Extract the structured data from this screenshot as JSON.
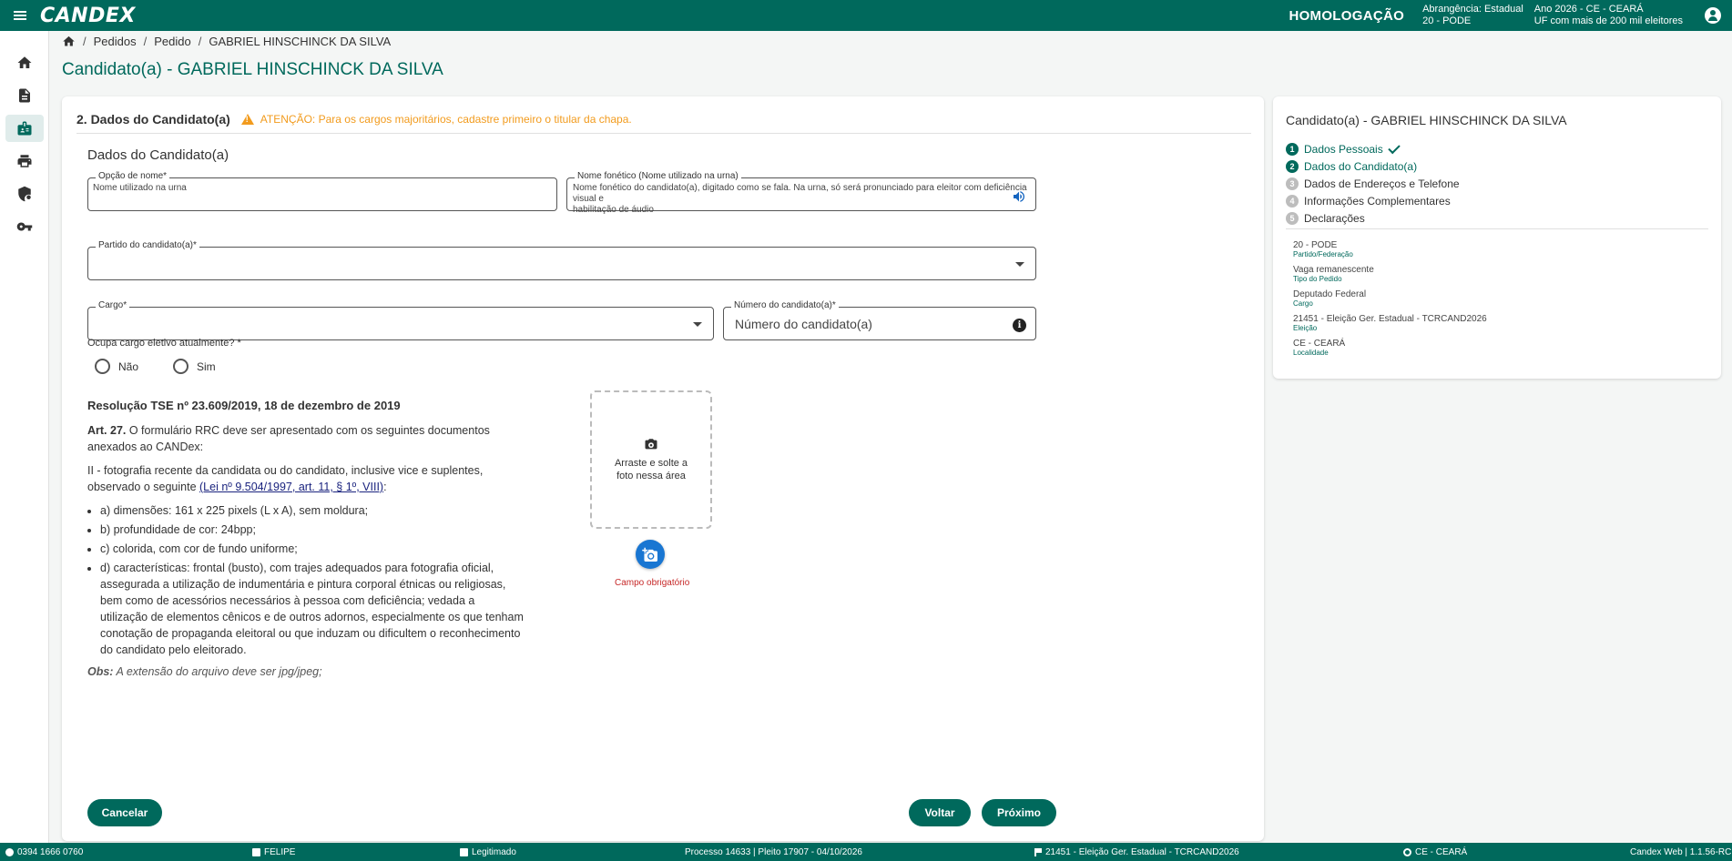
{
  "app": {
    "logo": "CANDEX"
  },
  "topbar": {
    "environment": "HOMOLOGAÇÃO",
    "scope_line1": "Abrangência: Estadual",
    "scope_line2": "20 - PODE",
    "year_line1": "Ano 2026 - CE - CEARÁ",
    "year_line2": "UF com mais de 200 mil eleitores"
  },
  "sidebar": {
    "items": [
      {
        "icon": "home-icon"
      },
      {
        "icon": "document-icon"
      },
      {
        "icon": "candidate-badge-icon",
        "active": true
      },
      {
        "icon": "print-icon"
      },
      {
        "icon": "shield-lock-icon"
      },
      {
        "icon": "key-icon"
      }
    ]
  },
  "breadcrumb": {
    "items": [
      "Pedidos",
      "Pedido",
      "GABRIEL HINSCHINCK DA SILVA"
    ]
  },
  "page_title": "Candidato(a) - GABRIEL HINSCHINCK DA SILVA",
  "section": {
    "title": "2. Dados do Candidato(a)",
    "warning": "ATENÇÃO: Para os cargos majoritários, cadastre primeiro o titular da chapa.",
    "subtitle": "Dados do Candidato(a)"
  },
  "form": {
    "opcao_nome": {
      "label": "Opção de nome*",
      "value": "",
      "hint": "Nome utilizado na urna"
    },
    "nome_fonetico": {
      "label": "Nome fonético (Nome utilizado na urna)",
      "value": "",
      "hint_line1": "Nome fonético do candidato(a), digitado como se fala. Na urna, só será pronunciado para eleitor com deficiência visual e",
      "hint_line2": "habilitação de áudio"
    },
    "partido": {
      "label": "Partido do candidato(a)*",
      "value": ""
    },
    "cargo": {
      "label": "Cargo*",
      "value": ""
    },
    "numero": {
      "label": "Número do candidato(a)*",
      "placeholder": "Número do candidato(a)"
    },
    "ocupa_cargo": {
      "question": "Ocupa cargo eletivo atualmente? *",
      "options": [
        "Não",
        "Sim"
      ]
    }
  },
  "resolution": {
    "title": "Resolução TSE nº 23.609/2019, 18 de dezembro de 2019",
    "art_label": "Art. 27.",
    "art_text": " O formulário RRC deve ser apresentado com os seguintes documentos anexados ao CANDex:",
    "item_intro": "II - fotografia recente da candidata ou do candidato, inclusive vice e suplentes, observado o seguinte ",
    "law_link": "(Lei nº 9.504/1997, art. 11, § 1º, VIII)",
    "law_link_suffix": ":",
    "items": [
      "a) dimensões: 161 x 225 pixels (L x A), sem moldura;",
      "b) profundidade de cor: 24bpp;",
      "c) colorida, com cor de fundo uniforme;",
      "d) características: frontal (busto), com trajes adequados para fotografia oficial, assegurada a utilização de indumentária e pintura corporal étnicas ou religiosas, bem como de acessórios necessários à pessoa com deficiência; vedada a utilização de elementos cênicos e de outros adornos, especialmente os que tenham conotação de propaganda eleitoral ou que induzam ou dificultem o reconhecimento do candidato pelo eleitorado."
    ],
    "obs_label": "Obs:",
    "obs_text": " A extensão do arquivo deve ser jpg/jpeg;"
  },
  "photo": {
    "dropzone_line1": "Arraste e solte a",
    "dropzone_line2": "foto nessa área",
    "required": "Campo obrigatório"
  },
  "buttons": {
    "cancel": "Cancelar",
    "back": "Voltar",
    "next": "Próximo"
  },
  "side": {
    "title": "Candidato(a) - GABRIEL HINSCHINCK DA SILVA",
    "steps": [
      {
        "num": "1",
        "label": "Dados Pessoais",
        "state": "done"
      },
      {
        "num": "2",
        "label": "Dados do Candidato(a)",
        "state": "current"
      },
      {
        "num": "3",
        "label": "Dados de Endereços e Telefone",
        "state": "pending"
      },
      {
        "num": "4",
        "label": "Informações Complementares",
        "state": "pending"
      },
      {
        "num": "5",
        "label": "Declarações",
        "state": "pending"
      }
    ],
    "meta": [
      {
        "value": "20 - PODE",
        "label": "Partido/Federação"
      },
      {
        "value": "Vaga remanescente",
        "label": "Tipo do Pedido"
      },
      {
        "value": "Deputado Federal",
        "label": "Cargo"
      },
      {
        "value": "21451 - Eleição Ger. Estadual - TCRCAND2026",
        "label": "Eleição"
      },
      {
        "value": "CE - CEARÁ",
        "label": "Localidade"
      }
    ]
  },
  "bottombar": {
    "phone": "0394 1666 0760",
    "user": "FELIPE",
    "legitimado": "Legitimado",
    "processo": "Processo 14633 | Pleito 17907 - 04/10/2026",
    "eleicao": "21451 - Eleição Ger. Estadual - TCRCAND2026",
    "uf": "CE - CEARÁ",
    "version": "Candex Web | 1.1.56-RC"
  }
}
